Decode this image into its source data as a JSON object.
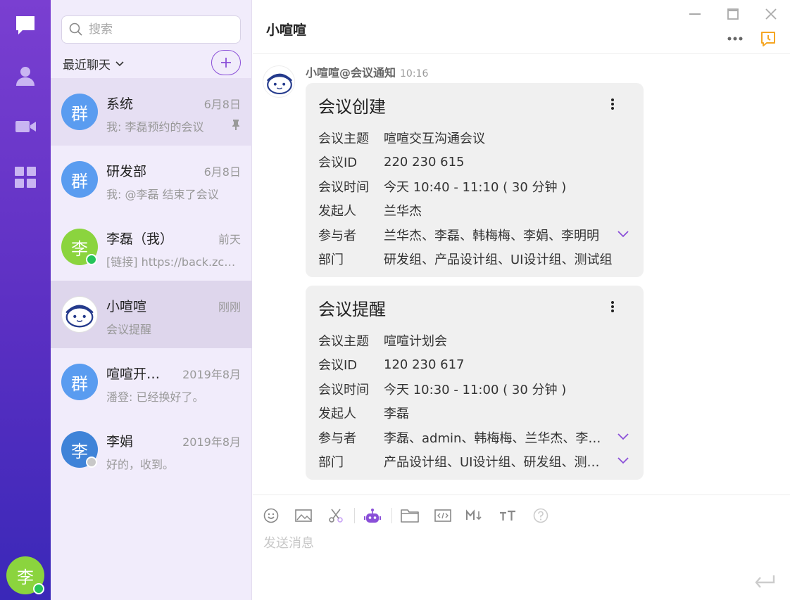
{
  "rail": {
    "items": [
      "chat-icon",
      "contacts-icon",
      "video-icon",
      "apps-icon"
    ],
    "user_avatar_char": "李"
  },
  "sidebar": {
    "search_placeholder": "搜索",
    "recent_label": "最近聊天",
    "conversations": [
      {
        "avatar_char": "群",
        "avatar_color": "#5a9cf0",
        "name": "系统",
        "time": "6月8日",
        "preview": "我: 李磊预约的会议",
        "pinned": true
      },
      {
        "avatar_char": "群",
        "avatar_color": "#5a9cf0",
        "name": "研发部",
        "time": "6月8日",
        "preview": "我: @李磊 结束了会议"
      },
      {
        "avatar_char": "李",
        "avatar_color": "#8bd43e",
        "name": "李磊（我）",
        "time": "前天",
        "preview": "[链接] https://back.zcloud.com",
        "online": true
      },
      {
        "avatar_char": "",
        "name": "小喧喧",
        "time": "刚刚",
        "preview": "会议提醒",
        "selected": true
      },
      {
        "avatar_char": "群",
        "avatar_color": "#5a9cf0",
        "name": "喧喧开发组",
        "time": "2019年8月",
        "preview": "潘登: 已经换好了。"
      },
      {
        "avatar_char": "李",
        "avatar_color": "#3f83d8",
        "name": "李娟",
        "time": "2019年8月",
        "preview": "好的，收到。",
        "offline": true
      }
    ]
  },
  "chat": {
    "title": "小喧喧",
    "sender": "小喧喧@会议通知",
    "time": "10:16",
    "cards": [
      {
        "title": "会议创建",
        "rows": [
          {
            "k": "会议主题",
            "v": "喧喧交互沟通会议"
          },
          {
            "k": "会议ID",
            "v": "220 230 615"
          },
          {
            "k": "会议时间",
            "v": "今天 10:40 - 11:10 ( 30 分钟 )"
          },
          {
            "k": "发起人",
            "v": "兰华杰"
          },
          {
            "k": "参与者",
            "v": "兰华杰、李磊、韩梅梅、李娟、李明明",
            "expand": true
          },
          {
            "k": "部门",
            "v": "研发组、产品设计组、UI设计组、测试组"
          }
        ]
      },
      {
        "title": "会议提醒",
        "rows": [
          {
            "k": "会议主题",
            "v": "喧喧计划会"
          },
          {
            "k": "会议ID",
            "v": "120 230 617"
          },
          {
            "k": "会议时间",
            "v": "今天 10:30 - 11:00 ( 30 分钟 )"
          },
          {
            "k": "发起人",
            "v": "李磊"
          },
          {
            "k": "参与者",
            "v": "李磊、admin、韩梅梅、兰华杰、李娟、李明明",
            "expand": true
          },
          {
            "k": "部门",
            "v": "产品设计组、UI设计组、研发组、测试组",
            "expand": true
          }
        ]
      }
    ],
    "input_placeholder": "发送消息",
    "toolbar": [
      "emoji-icon",
      "image-icon",
      "screenshot-icon",
      "robot-icon",
      "folder-icon",
      "code-icon",
      "markdown-icon",
      "font-size-icon",
      "help-icon"
    ]
  },
  "colors": {
    "accent": "#8a4fd8",
    "rail_top": "#7a3fd1",
    "rail_bottom": "#3a28b8",
    "online": "#25c45a",
    "reminder": "#f5a623"
  }
}
